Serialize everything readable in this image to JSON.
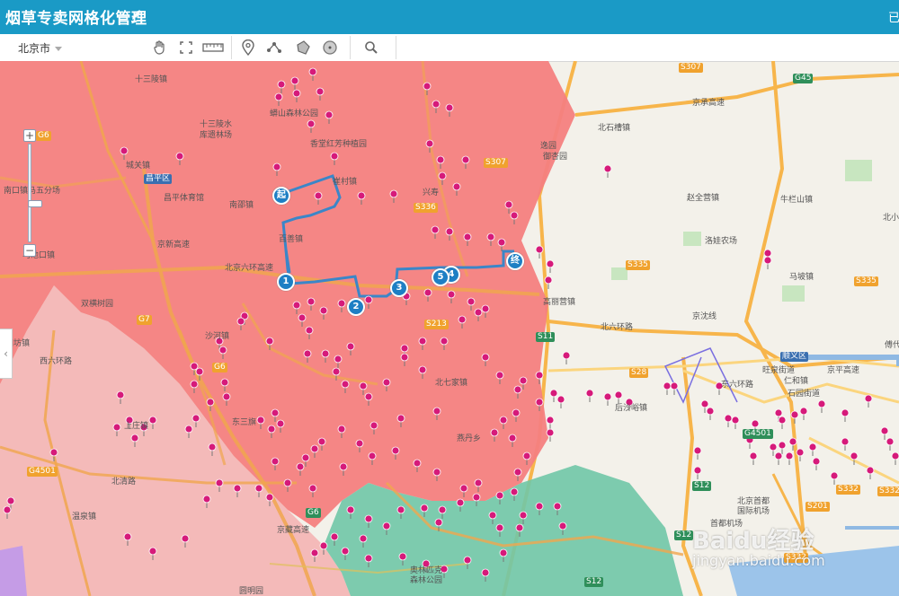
{
  "header": {
    "title": "烟草专卖网格化管理",
    "right_text": "已"
  },
  "toolbar": {
    "city": "北京市"
  },
  "icons": {
    "edit": "pencil-icon",
    "pan": "hand-icon",
    "fullscreen": "fullscreen-icon",
    "measure": "ruler-icon",
    "marker": "location-pin-icon",
    "line": "polyline-icon",
    "polygon": "polygon-icon",
    "circle": "circle-icon",
    "search": "search-icon"
  },
  "zoom": {
    "plus": "+",
    "minus": "−"
  },
  "route": {
    "start_label": "起",
    "end_label": "终",
    "waypoints": [
      "1",
      "2",
      "3",
      "4",
      "5"
    ]
  },
  "places": [
    {
      "text": "十三陵镇"
    },
    {
      "text": "十三陵水"
    },
    {
      "text": "库遗林场"
    },
    {
      "text": "崔村镇"
    },
    {
      "text": "香堂红芳种植园"
    },
    {
      "text": "城关镇"
    },
    {
      "text": "南口镇马五分场"
    },
    {
      "text": "昌平区"
    },
    {
      "text": "昌平体育馆"
    },
    {
      "text": "南邵镇"
    },
    {
      "text": "百善镇"
    },
    {
      "text": "兴寿"
    },
    {
      "text": "马池口镇"
    },
    {
      "text": "北京六环高速"
    },
    {
      "text": "双横树园"
    },
    {
      "text": "阳坊镇"
    },
    {
      "text": "沙河镇"
    },
    {
      "text": "北七家镇"
    },
    {
      "text": "东三旗"
    },
    {
      "text": "上庄镇"
    },
    {
      "text": "北清路"
    },
    {
      "text": "温泉镇"
    },
    {
      "text": "燕丹乡"
    },
    {
      "text": "北石槽镇"
    },
    {
      "text": "逸园"
    },
    {
      "text": "御杏园"
    },
    {
      "text": "赵全营镇"
    },
    {
      "text": "牛栏山镇"
    },
    {
      "text": "洛娃农场"
    },
    {
      "text": "马坡镇"
    },
    {
      "text": "后沙峪镇"
    },
    {
      "text": "旺泉街道"
    },
    {
      "text": "仁和镇"
    },
    {
      "text": "石园街道"
    },
    {
      "text": "北京首都"
    },
    {
      "text": "国际机场"
    },
    {
      "text": "首都机场"
    },
    {
      "text": "北石槽"
    },
    {
      "text": "北六环路"
    },
    {
      "text": "高丽营镇"
    },
    {
      "text": "顺义区"
    },
    {
      "text": "京承高速"
    },
    {
      "text": "东六环路"
    },
    {
      "text": "圆明园"
    },
    {
      "text": "奥林匹克"
    },
    {
      "text": "森林公园"
    },
    {
      "text": "京藏高速"
    },
    {
      "text": "京新高速"
    },
    {
      "text": "西六环路"
    },
    {
      "text": "京沈线"
    },
    {
      "text": "北小"
    },
    {
      "text": "傅代"
    },
    {
      "text": "蟒山森林公园"
    },
    {
      "text": "京平高速"
    }
  ],
  "roads": [
    "S307",
    "G45",
    "G6",
    "S336",
    "S335",
    "S213",
    "S11",
    "S28",
    "G4501",
    "S12",
    "S201",
    "S332",
    "G7"
  ],
  "watermark": {
    "text": "Baidu经验",
    "sub": "jingyan.baidu.com"
  }
}
